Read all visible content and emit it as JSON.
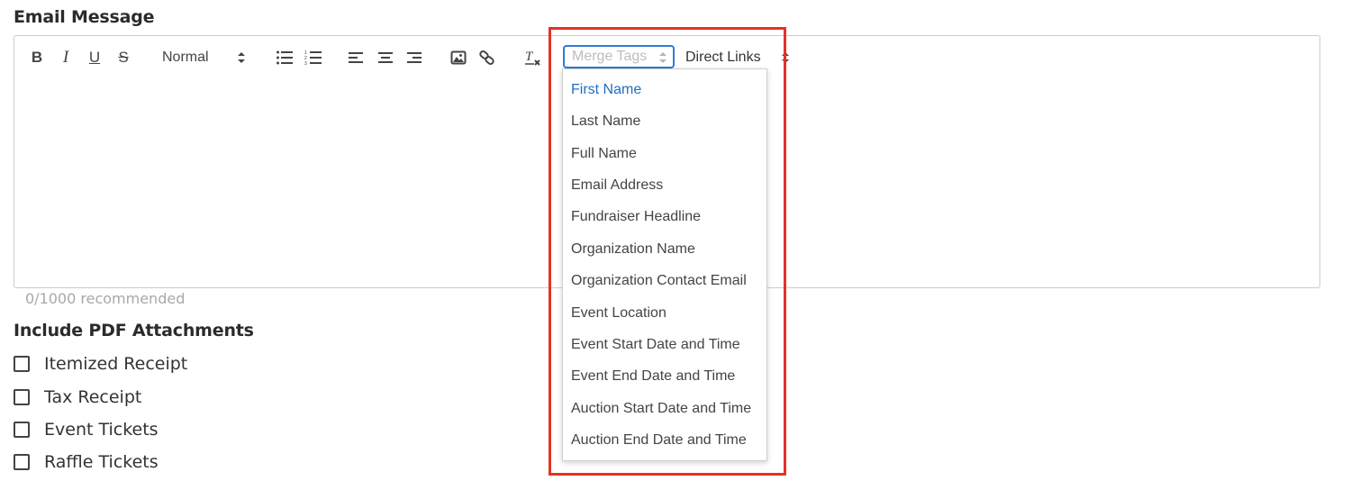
{
  "email_message": {
    "label": "Email Message",
    "toolbar": {
      "bold_label": "B",
      "italic_label": "I",
      "underline_label": "U",
      "strike_label": "S",
      "header_select_value": "Normal",
      "icons": [
        "bold-icon",
        "italic-icon",
        "underline-icon",
        "strikethrough-icon",
        "bullet-list-icon",
        "ordered-list-icon",
        "align-left-icon",
        "align-center-icon",
        "align-right-icon",
        "image-icon",
        "link-icon",
        "clear-format-icon"
      ],
      "merge_tags_placeholder": "Merge Tags",
      "direct_links_value": "Direct Links"
    },
    "counter": "0/1000 recommended"
  },
  "merge_tags_dropdown": {
    "items": [
      "First Name",
      "Last Name",
      "Full Name",
      "Email Address",
      "Fundraiser Headline",
      "Organization Name",
      "Organization Contact Email",
      "Event Location",
      "Event Start Date and Time",
      "Event End Date and Time",
      "Auction Start Date and Time",
      "Auction End Date and Time"
    ],
    "active_index": 0,
    "active_color": "#1f6ec5"
  },
  "pdf_attachments": {
    "label": "Include PDF Attachments",
    "options": [
      "Itemized Receipt",
      "Tax Receipt",
      "Event Tickets",
      "Raffle Tickets"
    ]
  },
  "highlight_color": "#e53224"
}
